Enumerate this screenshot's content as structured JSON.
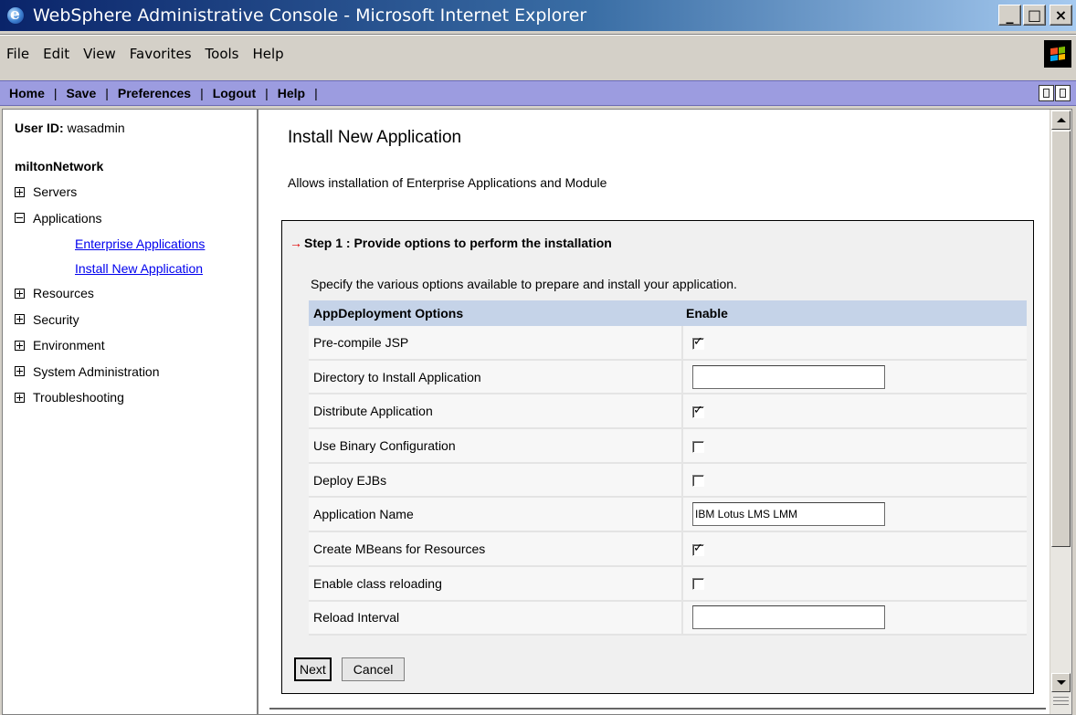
{
  "window": {
    "title": "WebSphere Administrative Console - Microsoft Internet Explorer",
    "minimize": "_",
    "maximize": "□",
    "close": "×"
  },
  "menu": {
    "file": "File",
    "edit": "Edit",
    "view": "View",
    "favorites": "Favorites",
    "tools": "Tools",
    "help": "Help"
  },
  "console_nav": {
    "home": "Home",
    "save": "Save",
    "preferences": "Preferences",
    "logout": "Logout",
    "help": "Help",
    "separator": "|"
  },
  "sidebar": {
    "user_label": "User ID:",
    "user_value": "wasadmin",
    "cell_name": "miltonNetwork",
    "items": [
      {
        "label": "Servers",
        "state": "collapsed"
      },
      {
        "label": "Applications",
        "state": "expanded",
        "children": [
          {
            "label": "Enterprise Applications"
          },
          {
            "label": "Install New Application"
          }
        ]
      },
      {
        "label": "Resources",
        "state": "collapsed"
      },
      {
        "label": "Security",
        "state": "collapsed"
      },
      {
        "label": "Environment",
        "state": "collapsed"
      },
      {
        "label": "System Administration",
        "state": "collapsed"
      },
      {
        "label": "Troubleshooting",
        "state": "collapsed"
      }
    ]
  },
  "main": {
    "title": "Install New Application",
    "description": "Allows installation of Enterprise Applications and Module",
    "step": {
      "arrow": "→",
      "title": "Step 1 :  Provide options to perform the installation",
      "instructions": "Specify the various options available to prepare and install your application.",
      "table": {
        "headers": [
          "AppDeployment Options",
          "Enable"
        ],
        "rows": [
          {
            "label": "Pre-compile JSP",
            "type": "checkbox",
            "checked": true
          },
          {
            "label": "Directory to Install Application",
            "type": "text",
            "value": ""
          },
          {
            "label": "Distribute Application",
            "type": "checkbox",
            "checked": true
          },
          {
            "label": "Use Binary Configuration",
            "type": "checkbox",
            "checked": false
          },
          {
            "label": "Deploy EJBs",
            "type": "checkbox",
            "checked": false
          },
          {
            "label": "Application Name",
            "type": "text",
            "value": "IBM Lotus LMS LMM"
          },
          {
            "label": "Create MBeans for Resources",
            "type": "checkbox",
            "checked": true
          },
          {
            "label": "Enable class reloading",
            "type": "checkbox",
            "checked": false
          },
          {
            "label": "Reload Interval",
            "type": "text",
            "value": ""
          }
        ]
      },
      "next_label": "Next",
      "cancel_label": "Cancel"
    }
  },
  "colors": {
    "title_bar_start": "#0a246a",
    "nav_bar": "#9c9ce0",
    "table_header": "#c5d3e8",
    "link": "#0000ee",
    "step_arrow": "#e00000"
  }
}
